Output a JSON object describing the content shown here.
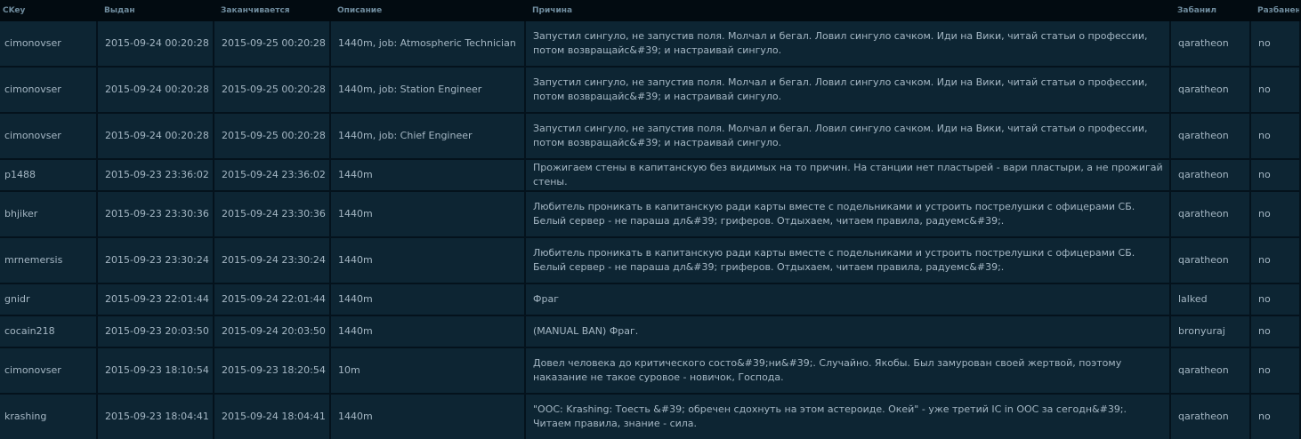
{
  "columns": [
    "CKey",
    "Выдан",
    "Заканчивается",
    "Описание",
    "Причина",
    "Забанил",
    "Разбанен"
  ],
  "rows": [
    {
      "ckey": "cimonovser",
      "issued": "2015-09-24 00:20:28",
      "expires": "2015-09-25 00:20:28",
      "description": "1440m, job: Atmospheric Technician",
      "reason": "Запустил сингуло, не запустив поля. Молчал и бегал. Ловил сингуло сачком. Иди на Вики, читай статьи о профессии, потом возвращайс&#39; и настраивай сингуло.",
      "admin": "qaratheon",
      "unbanned": "no"
    },
    {
      "ckey": "cimonovser",
      "issued": "2015-09-24 00:20:28",
      "expires": "2015-09-25 00:20:28",
      "description": "1440m, job: Station Engineer",
      "reason": "Запустил сингуло, не запустив поля. Молчал и бегал. Ловил сингуло сачком. Иди на Вики, читай статьи о профессии, потом возвращайс&#39; и настраивай сингуло.",
      "admin": "qaratheon",
      "unbanned": "no"
    },
    {
      "ckey": "cimonovser",
      "issued": "2015-09-24 00:20:28",
      "expires": "2015-09-25 00:20:28",
      "description": "1440m, job: Chief Engineer",
      "reason": "Запустил сингуло, не запустив поля. Молчал и бегал. Ловил сингуло сачком. Иди на Вики, читай статьи о профессии, потом возвращайс&#39; и настраивай сингуло.",
      "admin": "qaratheon",
      "unbanned": "no"
    },
    {
      "ckey": "p1488",
      "issued": "2015-09-23 23:36:02",
      "expires": "2015-09-24 23:36:02",
      "description": "1440m",
      "reason": "Прожигаем стены в капитанскую без видимых на то причин. На станции нет пластырей - вари пластыри, а не прожигай стены.",
      "admin": "qaratheon",
      "unbanned": "no"
    },
    {
      "ckey": "bhjiker",
      "issued": "2015-09-23 23:30:36",
      "expires": "2015-09-24 23:30:36",
      "description": "1440m",
      "reason": "Любитель проникать в капитанскую ради карты вместе с подельниками и устроить пострелушки с офицерами СБ. Белый сервер - не параша дл&#39; гриферов. Отдыхаем, читаем правила, радуемс&#39;.",
      "admin": "qaratheon",
      "unbanned": "no"
    },
    {
      "ckey": "mrnemersis",
      "issued": "2015-09-23 23:30:24",
      "expires": "2015-09-24 23:30:24",
      "description": "1440m",
      "reason": "Любитель проникать в капитанскую ради карты вместе с подельниками и устроить пострелушки с офицерами СБ. Белый сервер - не параша дл&#39; гриферов. Отдыхаем, читаем правила, радуемс&#39;.",
      "admin": "qaratheon",
      "unbanned": "no"
    },
    {
      "ckey": "gnidr",
      "issued": "2015-09-23 22:01:44",
      "expires": "2015-09-24 22:01:44",
      "description": "1440m",
      "reason": "Фраг",
      "admin": "lalked",
      "unbanned": "no"
    },
    {
      "ckey": "cocain218",
      "issued": "2015-09-23 20:03:50",
      "expires": "2015-09-24 20:03:50",
      "description": "1440m",
      "reason": "(MANUAL BAN) Фраг.",
      "admin": "bronyuraj",
      "unbanned": "no"
    },
    {
      "ckey": "cimonovser",
      "issued": "2015-09-23 18:10:54",
      "expires": "2015-09-23 18:20:54",
      "description": "10m",
      "reason": "Довел человека до критического состо&#39;ни&#39;. Случайно. Якобы. Был замурован своей жертвой, поэтому наказание не такое суровое - новичок, Господа.",
      "admin": "qaratheon",
      "unbanned": "no"
    },
    {
      "ckey": "krashing",
      "issued": "2015-09-23 18:04:41",
      "expires": "2015-09-24 18:04:41",
      "description": "1440m",
      "reason": "\"OOC: Krashing: Тоесть &#39; обречен сдохнуть на этом астероиде. Окей\" - уже третий IC in OOC за сегодн&#39;. Читаем правила, знание - сила.",
      "admin": "qaratheon",
      "unbanned": "no"
    }
  ]
}
